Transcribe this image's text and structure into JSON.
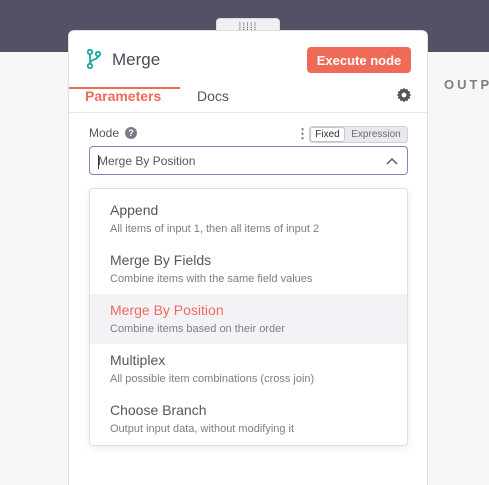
{
  "node": {
    "title": "Merge",
    "execute_label": "Execute node"
  },
  "tabs": {
    "parameters": "Parameters",
    "docs": "Docs"
  },
  "output_label": "OUTP",
  "mode": {
    "label": "Mode",
    "help_glyph": "?",
    "toggle_fixed": "Fixed",
    "toggle_expression": "Expression",
    "selected_value": "Merge By Position"
  },
  "options": [
    {
      "title": "Append",
      "description": "All items of input 1, then all items of input 2"
    },
    {
      "title": "Merge By Fields",
      "description": "Combine items with the same field values"
    },
    {
      "title": "Merge By Position",
      "description": "Combine items based on their order"
    },
    {
      "title": "Multiplex",
      "description": "All possible item combinations (cross join)"
    },
    {
      "title": "Choose Branch",
      "description": "Output input data, without modifying it"
    }
  ],
  "colors": {
    "accent": "#f06a58",
    "topbar": "#545066",
    "focus_border": "#8b7fb8"
  },
  "icons": {
    "node": "merge-branch-icon",
    "settings": "gear-icon",
    "help": "question-circle-icon",
    "more": "kebab-icon",
    "dropdown": "chevron-up-icon",
    "drag": "drag-handle-icon"
  }
}
